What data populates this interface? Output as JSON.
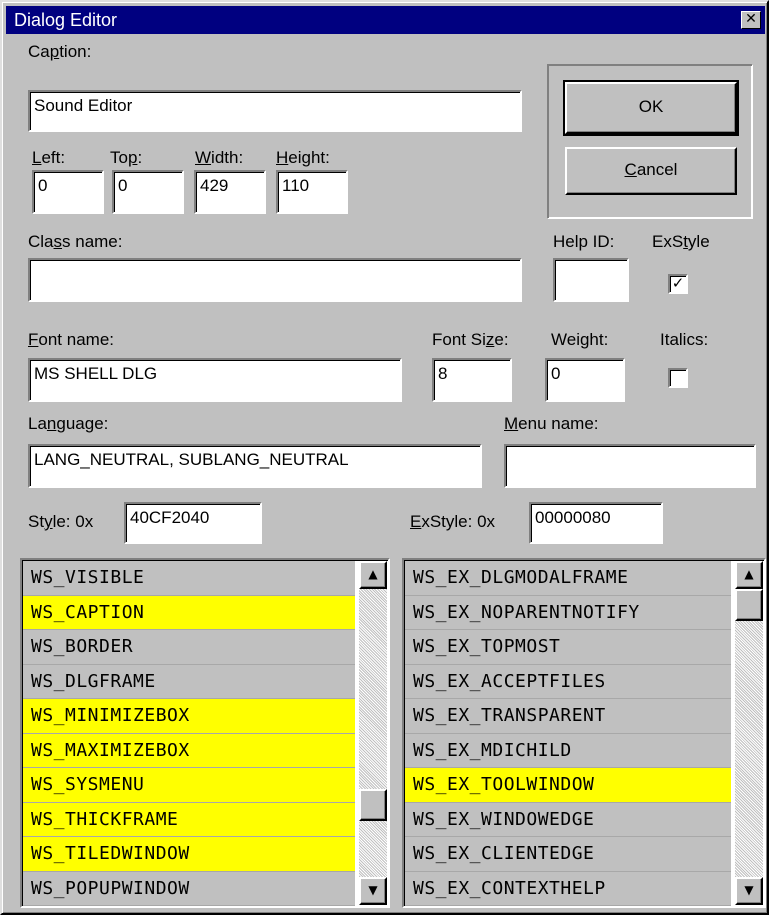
{
  "window": {
    "title": "Dialog Editor",
    "close_glyph": "✕"
  },
  "caption": {
    "label_pre": "Ca",
    "label_key": "p",
    "label_post": "tion:",
    "value": "Sound Editor"
  },
  "dims": {
    "left": {
      "label_key": "L",
      "label_post": "eft:",
      "value": "0"
    },
    "top": {
      "label_pre": "To",
      "label_key": "p",
      "label_post": ":",
      "value": "0"
    },
    "width": {
      "label_key": "W",
      "label_post": "idth:",
      "value": "429"
    },
    "height": {
      "label_key": "H",
      "label_post": "eight:",
      "value": "110"
    }
  },
  "buttons": {
    "ok": "OK",
    "cancel_key": "C",
    "cancel_post": "ancel"
  },
  "class_name": {
    "label_pre": "Cla",
    "label_key": "s",
    "label_post": "s name:",
    "value": ""
  },
  "help_id": {
    "label": "Help ID:",
    "value": ""
  },
  "exstyle_flag": {
    "label_pre": "ExS",
    "label_key": "t",
    "label_post": "yle",
    "checked": true,
    "mark": "✓"
  },
  "font": {
    "name_label_key": "F",
    "name_label_post": "ont name:",
    "name_value": "MS SHELL DLG",
    "size_label_pre": "Font Si",
    "size_label_key": "z",
    "size_label_post": "e:",
    "size_value": "8",
    "weight_label": "Weight:",
    "weight_value": "0",
    "italics_label": "Italics:",
    "italics_checked": false
  },
  "language": {
    "label_pre": "La",
    "label_key": "n",
    "label_post": "guage:",
    "value": "LANG_NEUTRAL, SUBLANG_NEUTRAL"
  },
  "menu": {
    "label_key": "M",
    "label_post": "enu name:",
    "value": ""
  },
  "style": {
    "label_pre": "St",
    "label_key": "y",
    "label_post": "le:  0x",
    "value": "40CF2040"
  },
  "exstyle": {
    "label_key": "E",
    "label_post": "xStyle:  0x",
    "value": "00000080"
  },
  "style_list": [
    {
      "name": "WS_VISIBLE",
      "on": false
    },
    {
      "name": "WS_CAPTION",
      "on": true
    },
    {
      "name": "WS_BORDER",
      "on": false
    },
    {
      "name": "WS_DLGFRAME",
      "on": false
    },
    {
      "name": "WS_MINIMIZEBOX",
      "on": true
    },
    {
      "name": "WS_MAXIMIZEBOX",
      "on": true
    },
    {
      "name": "WS_SYSMENU",
      "on": true
    },
    {
      "name": "WS_THICKFRAME",
      "on": true
    },
    {
      "name": "WS_TILEDWINDOW",
      "on": true
    },
    {
      "name": "WS_POPUPWINDOW",
      "on": false
    }
  ],
  "exstyle_list": [
    {
      "name": "WS_EX_DLGMODALFRAME",
      "on": false
    },
    {
      "name": "WS_EX_NOPARENTNOTIFY",
      "on": false
    },
    {
      "name": "WS_EX_TOPMOST",
      "on": false
    },
    {
      "name": "WS_EX_ACCEPTFILES",
      "on": false
    },
    {
      "name": "WS_EX_TRANSPARENT",
      "on": false
    },
    {
      "name": "WS_EX_MDICHILD",
      "on": false
    },
    {
      "name": "WS_EX_TOOLWINDOW",
      "on": true
    },
    {
      "name": "WS_EX_WINDOWEDGE",
      "on": false
    },
    {
      "name": "WS_EX_CLIENTEDGE",
      "on": false
    },
    {
      "name": "WS_EX_CONTEXTHELP",
      "on": false
    }
  ],
  "scroll": {
    "up_glyph": "▲",
    "down_glyph": "▼"
  },
  "colors": {
    "highlight": "#ffff00",
    "titlebar": "#000080",
    "face": "#c0c0c0"
  }
}
